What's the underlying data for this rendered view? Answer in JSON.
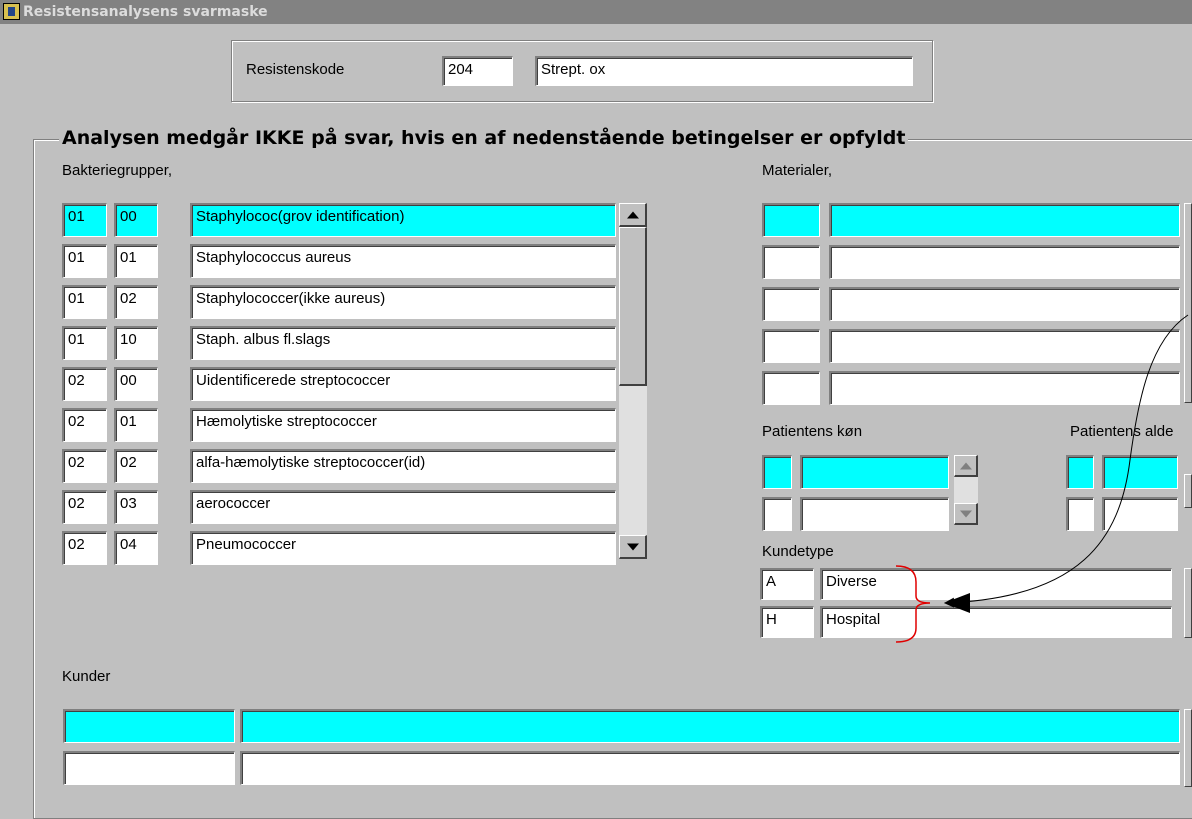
{
  "window": {
    "title": "Resistensanalysens svarmaske"
  },
  "header": {
    "code_label": "Resistenskode",
    "code_value": "204",
    "code_name": "Strept. ox"
  },
  "condition_heading": "Analysen medgår IKKE på svar, hvis en af nedenstående betingelser er opfyldt",
  "bacteria": {
    "label": "Bakteriegrupper,",
    "rows": [
      {
        "group": "01",
        "sub": "00",
        "name": "Staphylococ(grov identification)"
      },
      {
        "group": "01",
        "sub": "01",
        "name": "Staphylococcus aureus"
      },
      {
        "group": "01",
        "sub": "02",
        "name": "Staphylococcer(ikke aureus)"
      },
      {
        "group": "01",
        "sub": "10",
        "name": "Staph. albus fl.slags"
      },
      {
        "group": "02",
        "sub": "00",
        "name": "Uidentificerede streptococcer"
      },
      {
        "group": "02",
        "sub": "01",
        "name": "Hæmolytiske streptococcer"
      },
      {
        "group": "02",
        "sub": "02",
        "name": "alfa-hæmolytiske streptococcer(id)"
      },
      {
        "group": "02",
        "sub": "03",
        "name": "aerococcer"
      },
      {
        "group": "02",
        "sub": "04",
        "name": "Pneumococcer"
      }
    ]
  },
  "materials": {
    "label": "Materialer,"
  },
  "gender": {
    "label": "Patientens køn"
  },
  "age": {
    "label": "Patientens alde"
  },
  "customer_type": {
    "label": "Kundetype",
    "rows": [
      {
        "code": "A",
        "name": "Diverse"
      },
      {
        "code": "H",
        "name": "Hospital"
      }
    ]
  },
  "customers": {
    "label": "Kunder"
  },
  "colors": {
    "selected": "#00ffff",
    "face": "#c0c0c0",
    "annotation_bracket": "#e00000"
  },
  "icons": [
    "app-icon",
    "scroll-up-icon",
    "scroll-down-icon",
    "annotation-arrow-icon"
  ]
}
